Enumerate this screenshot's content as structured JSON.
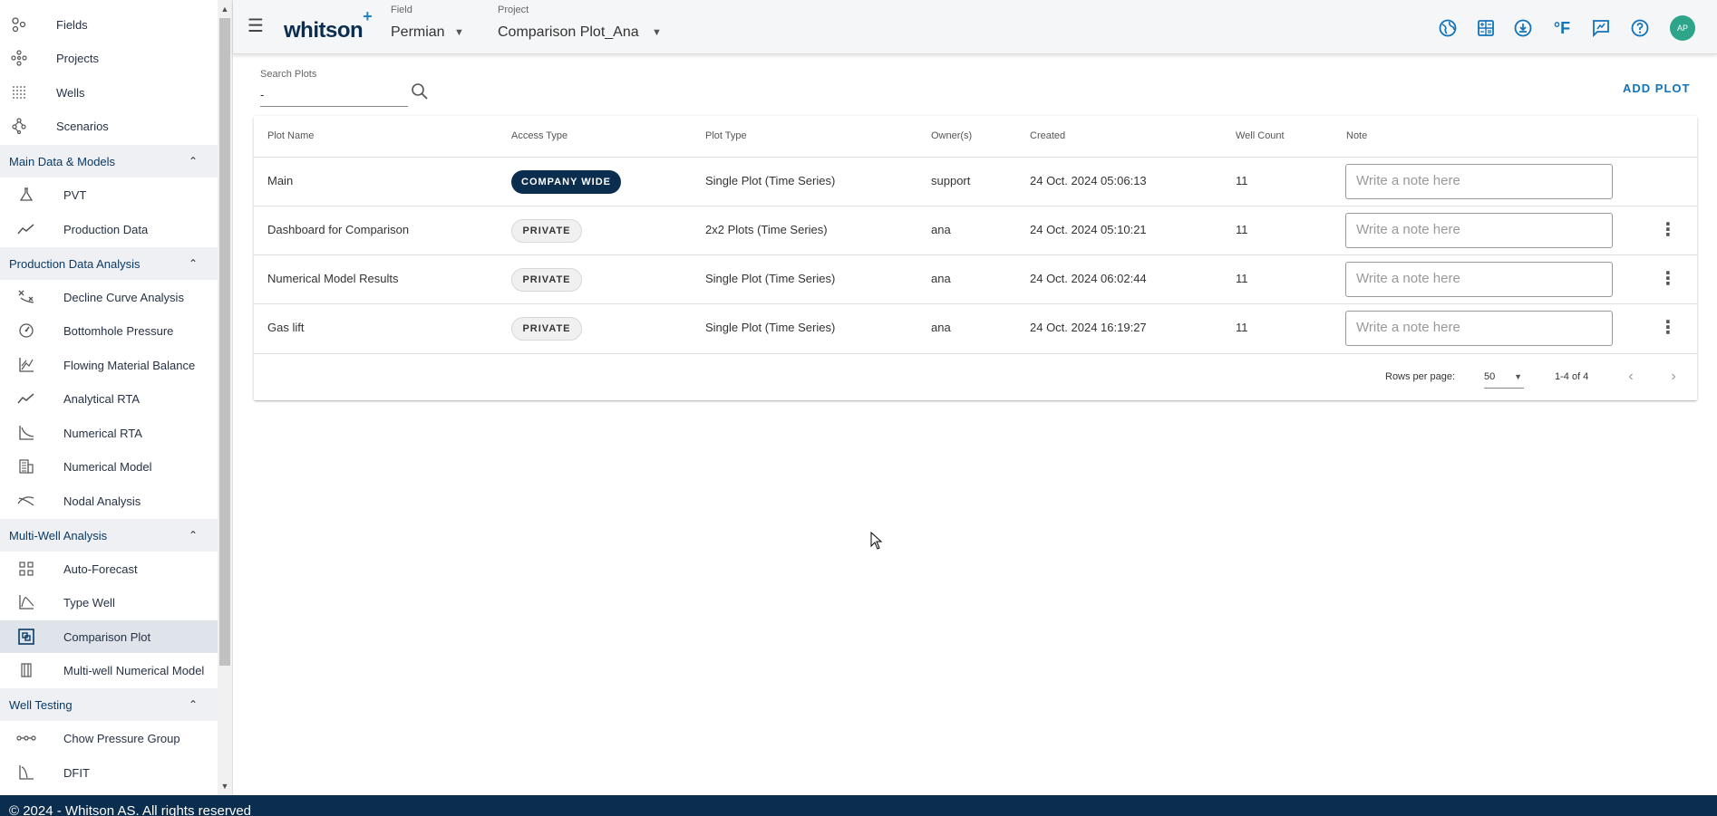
{
  "sidebar": {
    "top_items": [
      {
        "label": "Fields",
        "icon": "fields-icon"
      },
      {
        "label": "Projects",
        "icon": "projects-icon"
      },
      {
        "label": "Wells",
        "icon": "wells-icon"
      },
      {
        "label": "Scenarios",
        "icon": "scenarios-icon"
      }
    ],
    "sections": [
      {
        "title": "Main Data & Models",
        "items": [
          {
            "label": "PVT"
          },
          {
            "label": "Production Data"
          }
        ]
      },
      {
        "title": "Production Data Analysis",
        "items": [
          {
            "label": "Decline Curve Analysis"
          },
          {
            "label": "Bottomhole Pressure"
          },
          {
            "label": "Flowing Material Balance"
          },
          {
            "label": "Analytical RTA"
          },
          {
            "label": "Numerical RTA"
          },
          {
            "label": "Numerical Model"
          },
          {
            "label": "Nodal Analysis"
          }
        ]
      },
      {
        "title": "Multi-Well Analysis",
        "items": [
          {
            "label": "Auto-Forecast"
          },
          {
            "label": "Type Well"
          },
          {
            "label": "Comparison Plot",
            "active": true
          },
          {
            "label": "Multi-well Numerical Model"
          }
        ]
      },
      {
        "title": "Well Testing",
        "items": [
          {
            "label": "Chow Pressure Group"
          },
          {
            "label": "DFIT"
          }
        ]
      }
    ]
  },
  "header": {
    "logo_text": "whitson",
    "logo_plus": "+",
    "field_label": "Field",
    "field_value": "Permian",
    "project_label": "Project",
    "project_value": "Comparison Plot_Ana",
    "temp_unit": "°F",
    "avatar_initials": "AP"
  },
  "search": {
    "label": "Search Plots",
    "value": "-"
  },
  "add_plot_label": "ADD PLOT",
  "table": {
    "columns": [
      "Plot Name",
      "Access Type",
      "Plot Type",
      "Owner(s)",
      "Created",
      "Well Count",
      "Note"
    ],
    "note_placeholder": "Write a note here",
    "rows": [
      {
        "name": "Main",
        "access": "COMPANY WIDE",
        "type": "Single Plot (Time Series)",
        "owner": "support",
        "created": "24 Oct. 2024 05:06:13",
        "wells": "11",
        "menu": false
      },
      {
        "name": "Dashboard for Comparison",
        "access": "PRIVATE",
        "type": "2x2 Plots (Time Series)",
        "owner": "ana",
        "created": "24 Oct. 2024 05:10:21",
        "wells": "11",
        "menu": true
      },
      {
        "name": "Numerical Model Results",
        "access": "PRIVATE",
        "type": "Single Plot (Time Series)",
        "owner": "ana",
        "created": "24 Oct. 2024 06:02:44",
        "wells": "11",
        "menu": true
      },
      {
        "name": "Gas lift",
        "access": "PRIVATE",
        "type": "Single Plot (Time Series)",
        "owner": "ana",
        "created": "24 Oct. 2024 16:19:27",
        "wells": "11",
        "menu": true
      }
    ],
    "rows_per_page_label": "Rows per page:",
    "rows_per_page": "50",
    "range": "1-4 of 4"
  },
  "footer_text": "© 2024 - Whitson AS. All rights reserved",
  "colors": {
    "brand_navy": "#0b2e4f",
    "accent_blue": "#1173b9",
    "avatar_green": "#2ea58a"
  }
}
